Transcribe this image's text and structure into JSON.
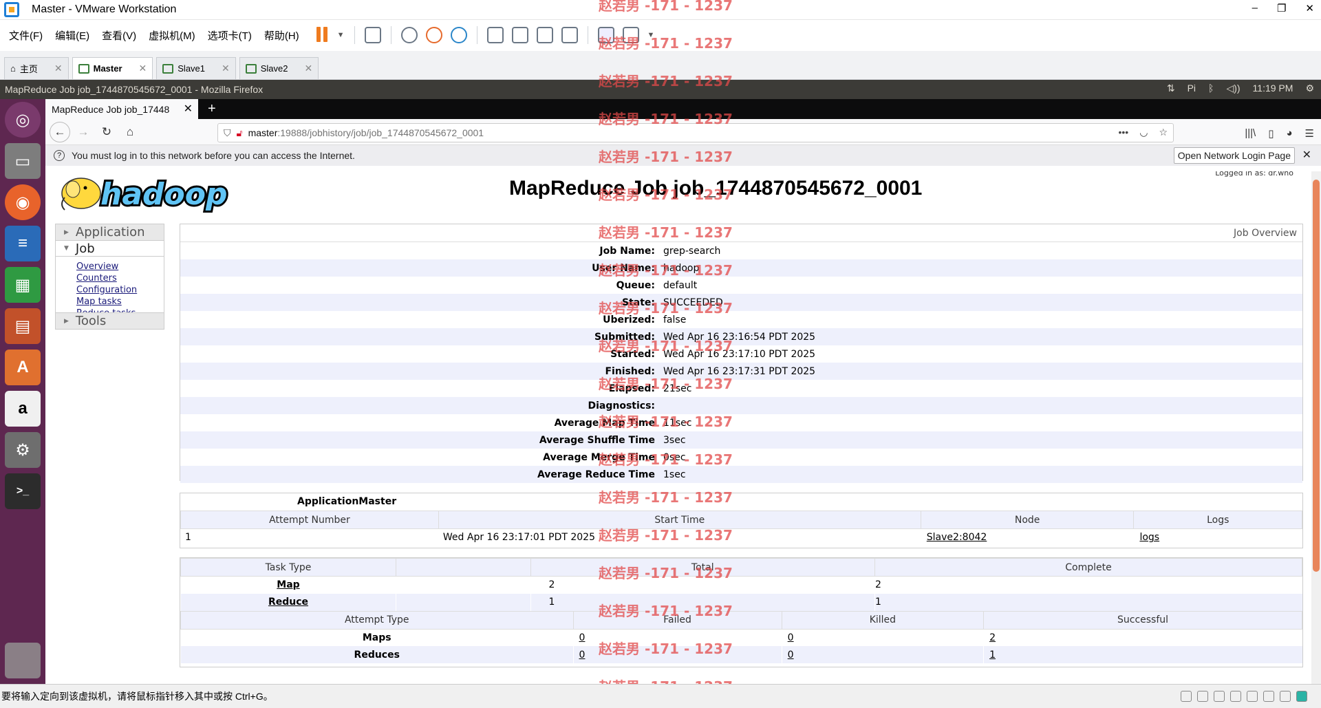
{
  "vmware": {
    "title": "Master - VMware Workstation",
    "menus": [
      "文件(F)",
      "编辑(E)",
      "查看(V)",
      "虚拟机(M)",
      "选项卡(T)",
      "帮助(H)"
    ],
    "tabs": [
      {
        "label": "主页",
        "active": false
      },
      {
        "label": "Master",
        "active": true
      },
      {
        "label": "Slave1",
        "active": false
      },
      {
        "label": "Slave2",
        "active": false
      }
    ],
    "status_text": "要将输入定向到该虚拟机，请将鼠标指针移入其中或按 Ctrl+G。",
    "accent": "#ef7b1e"
  },
  "ubuntu": {
    "window_title": "MapReduce Job job_1744870545672_0001 - Mozilla Firefox",
    "time": "11:19 PM",
    "launcher_color": "#5e2750"
  },
  "firefox": {
    "tab_title": "MapReduce Job job_17448",
    "url_host": "master",
    "url_path": ":19888/jobhistory/job/job_1744870545672_0001",
    "notice": "You must log in to this network before you can access the Internet.",
    "login_button": "Open Network Login Page"
  },
  "page": {
    "logo_text": "hadoop",
    "logged_in": "Logged in as: dr.who",
    "title": "MapReduce Job job_1744870545672_0001",
    "nav": {
      "application": "Application",
      "job": "Job",
      "job_links": [
        "Overview",
        "Counters",
        "Configuration",
        "Map tasks",
        "Reduce tasks"
      ],
      "tools": "Tools"
    },
    "overview": {
      "header": "Job Overview",
      "rows": [
        {
          "k": "Job Name:",
          "v": "grep-search"
        },
        {
          "k": "User Name:",
          "v": "hadoop"
        },
        {
          "k": "Queue:",
          "v": "default"
        },
        {
          "k": "State:",
          "v": "SUCCEEDED"
        },
        {
          "k": "Uberized:",
          "v": "false"
        },
        {
          "k": "Submitted:",
          "v": "Wed Apr 16 23:16:54 PDT 2025"
        },
        {
          "k": "Started:",
          "v": "Wed Apr 16 23:17:10 PDT 2025"
        },
        {
          "k": "Finished:",
          "v": "Wed Apr 16 23:17:31 PDT 2025"
        },
        {
          "k": "Elapsed:",
          "v": "21sec"
        },
        {
          "k": "Diagnostics:",
          "v": ""
        },
        {
          "k": "Average Map Time",
          "v": "11sec"
        },
        {
          "k": "Average Shuffle Time",
          "v": "3sec"
        },
        {
          "k": "Average Merge Time",
          "v": "0sec"
        },
        {
          "k": "Average Reduce Time",
          "v": "1sec"
        }
      ]
    },
    "am": {
      "title": "ApplicationMaster",
      "headers": [
        "Attempt Number",
        "Start Time",
        "Node",
        "Logs"
      ],
      "row": {
        "attempt": "1",
        "start": "Wed Apr 16 23:17:01 PDT 2025",
        "node": "Slave2:8042",
        "logs": "logs"
      }
    },
    "tasks": {
      "headers": [
        "Task Type",
        "Total",
        "Complete"
      ],
      "rows": [
        {
          "type": "Map",
          "total": "2",
          "complete": "2"
        },
        {
          "type": "Reduce",
          "total": "1",
          "complete": "1"
        }
      ],
      "attempt_headers": [
        "Attempt Type",
        "Failed",
        "Killed",
        "Successful"
      ],
      "attempt_rows": [
        {
          "type": "Maps",
          "failed": "0",
          "killed": "0",
          "successful": "2"
        },
        {
          "type": "Reduces",
          "failed": "0",
          "killed": "0",
          "successful": "1"
        }
      ]
    },
    "watermark": "赵若男 -171 - 1237"
  }
}
